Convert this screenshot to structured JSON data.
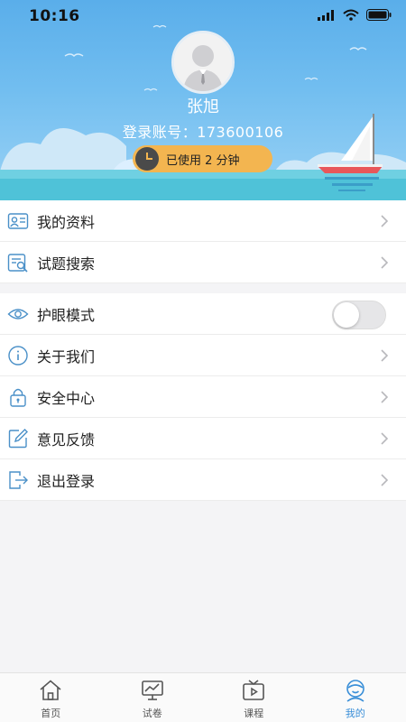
{
  "status_bar": {
    "time": "10:16"
  },
  "profile": {
    "name": "张旭",
    "account": "登录账号：173600106",
    "usage": "已使用 2 分钟"
  },
  "menu_group_1": [
    {
      "label": "我的资料",
      "icon": "profile-card-icon"
    },
    {
      "label": "试题搜索",
      "icon": "search-doc-icon"
    }
  ],
  "menu_group_2": [
    {
      "label": "护眼模式",
      "icon": "eye-icon",
      "toggle": false
    },
    {
      "label": "关于我们",
      "icon": "info-icon"
    },
    {
      "label": "安全中心",
      "icon": "lock-icon"
    },
    {
      "label": "意见反馈",
      "icon": "edit-icon"
    },
    {
      "label": "退出登录",
      "icon": "logout-icon"
    }
  ],
  "tabs": [
    {
      "label": "首页",
      "icon": "home-icon",
      "active": false
    },
    {
      "label": "试卷",
      "icon": "chart-screen-icon",
      "active": false
    },
    {
      "label": "课程",
      "icon": "tv-play-icon",
      "active": false
    },
    {
      "label": "我的",
      "icon": "user-icon",
      "active": true
    }
  ],
  "colors": {
    "sky": "#5aaeea",
    "accent": "#3a8fd8",
    "pill": "#f3b550",
    "icon": "#4a90c8"
  }
}
